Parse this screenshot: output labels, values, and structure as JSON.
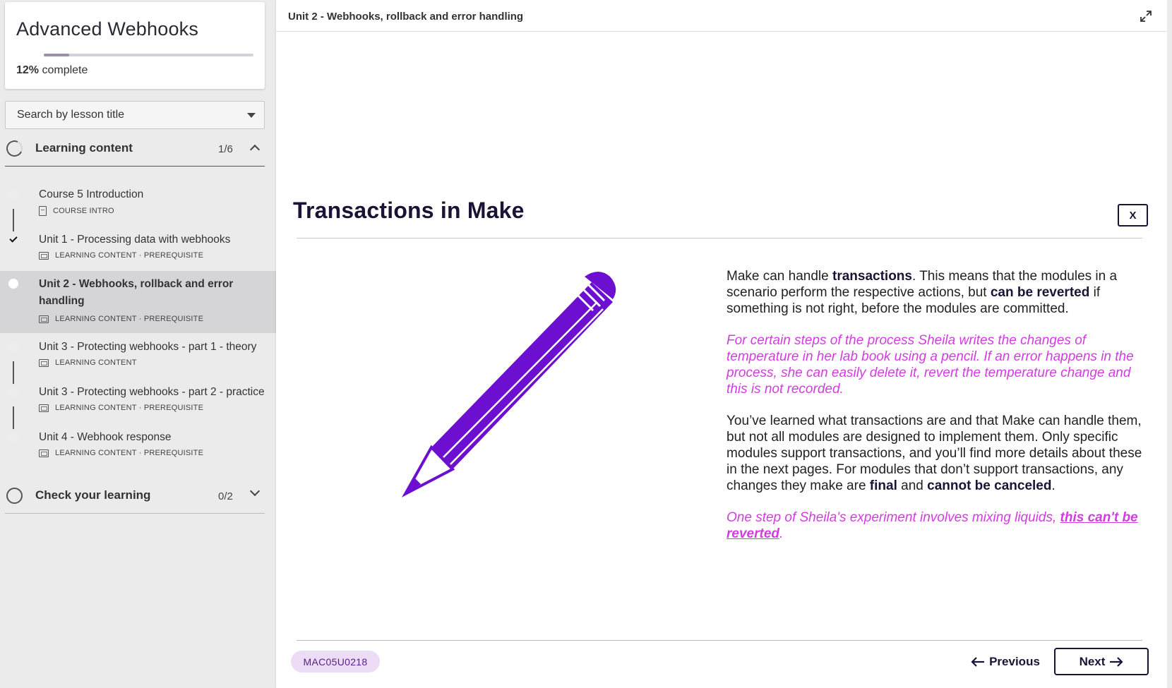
{
  "sidebar": {
    "course_title": "Advanced Webhooks",
    "progress_percent": "12%",
    "progress_suffix": " complete",
    "progress_value": 0.12,
    "search_placeholder": "Search by lesson title",
    "sections": [
      {
        "title": "Learning content",
        "count": "1/6",
        "expanded": true,
        "lessons": [
          {
            "title": "Course 5 Introduction",
            "meta": "COURSE INTRO",
            "done": false,
            "active": false
          },
          {
            "title": "Unit 1 - Processing data with webhooks",
            "meta": "LEARNING CONTENT · PREREQUISITE",
            "done": true,
            "active": false
          },
          {
            "title": "Unit 2 - Webhooks, rollback and error handling",
            "meta": "LEARNING CONTENT · PREREQUISITE",
            "done": false,
            "active": true
          },
          {
            "title": "Unit 3 - Protecting webhooks - part 1 - theory",
            "meta": "LEARNING CONTENT",
            "done": false,
            "active": false
          },
          {
            "title": "Unit 3 - Protecting webhooks - part 2 - practice",
            "meta": "LEARNING CONTENT · PREREQUISITE",
            "done": false,
            "active": false
          },
          {
            "title": "Unit 4 - Webhook response",
            "meta": "LEARNING CONTENT · PREREQUISITE",
            "done": false,
            "active": false
          }
        ]
      },
      {
        "title": "Check your learning",
        "count": "0/2",
        "expanded": false
      }
    ]
  },
  "main": {
    "breadcrumb": "Unit 2 - Webhooks, rollback and error handling",
    "page_title": "Transactions in Make",
    "close_label": "X",
    "paragraphs": {
      "p1_a": "Make can handle ",
      "p1_b": "transactions",
      "p1_c": ". This means that the modules in a scenario perform the respective actions, but ",
      "p1_d": "can be reverted",
      "p1_e": " if something is not right, before the modules are committed.",
      "p2": "For certain steps of the process Sheila writes the changes of temperature in her lab book using a pencil. If an error happens in the process, she can easily delete it, revert the temperature change and this is not recorded.",
      "p3_a": "You’ve learned what transactions are and that Make can handle them, but not all modules are designed to implement them. Only specific modules support transactions, and you’ll find more details about these in the next pages. For modules that don’t support transactions, any changes they make are ",
      "p3_b": "final",
      "p3_c": " and ",
      "p3_d": "cannot be canceled",
      "p3_e": ".",
      "p4_a": "One step of Sheila's experiment involves mixing liquids, ",
      "p4_b": "this can't be reverted",
      "p4_c": "."
    },
    "lesson_code": "MAC05U0218",
    "prev_label": "Previous",
    "next_label": "Next"
  },
  "colors": {
    "brand_dark": "#1c1236",
    "accent_purple": "#6d0fd0",
    "pink_text": "#d23ce0",
    "badge_bg": "#eddcf5"
  }
}
